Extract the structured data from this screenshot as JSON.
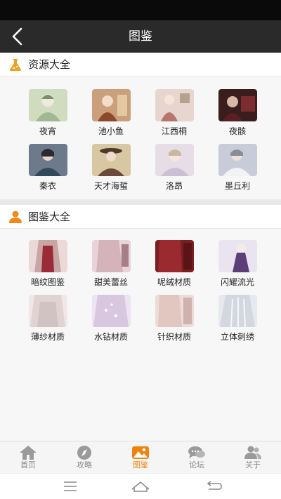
{
  "header": {
    "title": "图鉴",
    "back_icon": "chevron-left-icon"
  },
  "sections": [
    {
      "title": "资源大全",
      "icon": "flask-icon",
      "icon_color": "#f0a020",
      "items": [
        {
          "label": "夜宵"
        },
        {
          "label": "池小鱼"
        },
        {
          "label": "江西桐"
        },
        {
          "label": "夜骸"
        },
        {
          "label": "秦衣"
        },
        {
          "label": "天才海蜇"
        },
        {
          "label": "洛昂"
        },
        {
          "label": "墨丘利"
        }
      ]
    },
    {
      "title": "图鉴大全",
      "icon": "person-icon",
      "icon_color": "#f08a1a",
      "items": [
        {
          "label": "暗纹图鉴"
        },
        {
          "label": "甜美蕾丝"
        },
        {
          "label": "呢绒材质"
        },
        {
          "label": "闪耀流光"
        },
        {
          "label": "薄纱材质"
        },
        {
          "label": "水钻材质"
        },
        {
          "label": "针织材质"
        },
        {
          "label": "立体刺绣"
        }
      ]
    }
  ],
  "tabs": [
    {
      "label": "首页",
      "icon": "home-icon",
      "active": false
    },
    {
      "label": "攻略",
      "icon": "compass-icon",
      "active": false
    },
    {
      "label": "图鉴",
      "icon": "picture-icon",
      "active": true
    },
    {
      "label": "论坛",
      "icon": "chat-bubbles-icon",
      "active": false
    },
    {
      "label": "关于",
      "icon": "users-icon",
      "active": false
    }
  ],
  "colors": {
    "accent": "#f0820f",
    "header_bg": "#2a2a2a",
    "tab_inactive": "#9a9a9a"
  },
  "system_nav": {
    "menu": "menu-icon",
    "home": "home-outline-icon",
    "back": "back-arrow-icon"
  }
}
